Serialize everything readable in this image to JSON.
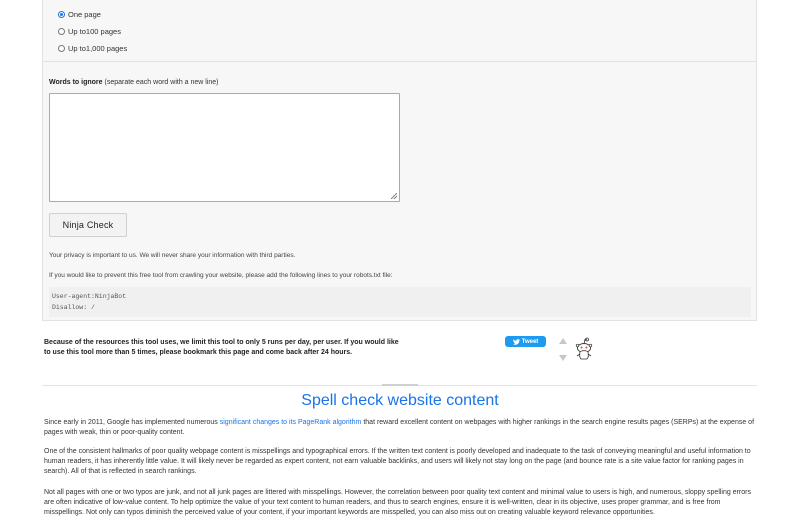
{
  "options": {
    "pages": [
      {
        "label": "One page",
        "checked": true
      },
      {
        "label": "Up to100 pages",
        "checked": false
      },
      {
        "label": "Up to1,000 pages",
        "checked": false
      }
    ]
  },
  "ignore": {
    "label": "Words to ignore",
    "hint": "(separate each word with a new line)",
    "value": ""
  },
  "ninja_button": "Ninja Check",
  "privacy_text": "Your privacy is important to us. We will never share your information with third parties.",
  "robots_text": "If you would like to prevent this free tool from crawling your website, please add the following lines to your robots.txt file:",
  "robots_code": {
    "line1": "User-agent:NinjaBot",
    "line2": "Disallow: /"
  },
  "limit_note": "Because of the resources this tool uses, we limit this tool to only 5 runs per day, per user. If you would like to use this tool more than 5 times, please bookmark this page and come back after 24 hours.",
  "share": {
    "tweet_label": "Tweet",
    "tweet_icon": "twitter-bird-icon",
    "reddit_icon": "reddit-alien-icon"
  },
  "article": {
    "title": "Spell check website content",
    "p1_before": "Since early in 2011, Google has implemented numerous ",
    "p1_link": "significant changes to its PageRank algorithm",
    "p1_after": " that reward excellent content on webpages with higher rankings in the search engine results pages (SERPs) at the expense of pages with weak, thin or poor-quality content.",
    "p2": "One of the consistent hallmarks of poor quality webpage content is misspellings and typographical errors. If the written text content is poorly developed and inadequate to the task of conveying meaningful and useful information to human readers, it has inherently little value. It will likely never be regarded as expert content, not earn valuable backlinks, and users will likely not stay long on the page (and bounce rate is a site value factor for ranking pages in search). All of that is reflected in search rankings.",
    "p3": "Not all pages with one or two typos are junk, and not all junk pages are littered with misspellings. However, the correlation between poor quality text content and minimal value to users is high, and numerous, sloppy spelling errors are often indicative of low-value content. To help optimize the value of your text content to human readers, and thus to search engines, ensure it is well-written, clear in its objective, uses proper grammar, and is free from misspellings. Not only can typos diminish the perceived value of your content, if your important keywords are misspelled, you can also miss out on creating valuable keyword relevance opportunities."
  },
  "colors": {
    "accent": "#1a73e8",
    "tweet": "#1d9bf0"
  }
}
